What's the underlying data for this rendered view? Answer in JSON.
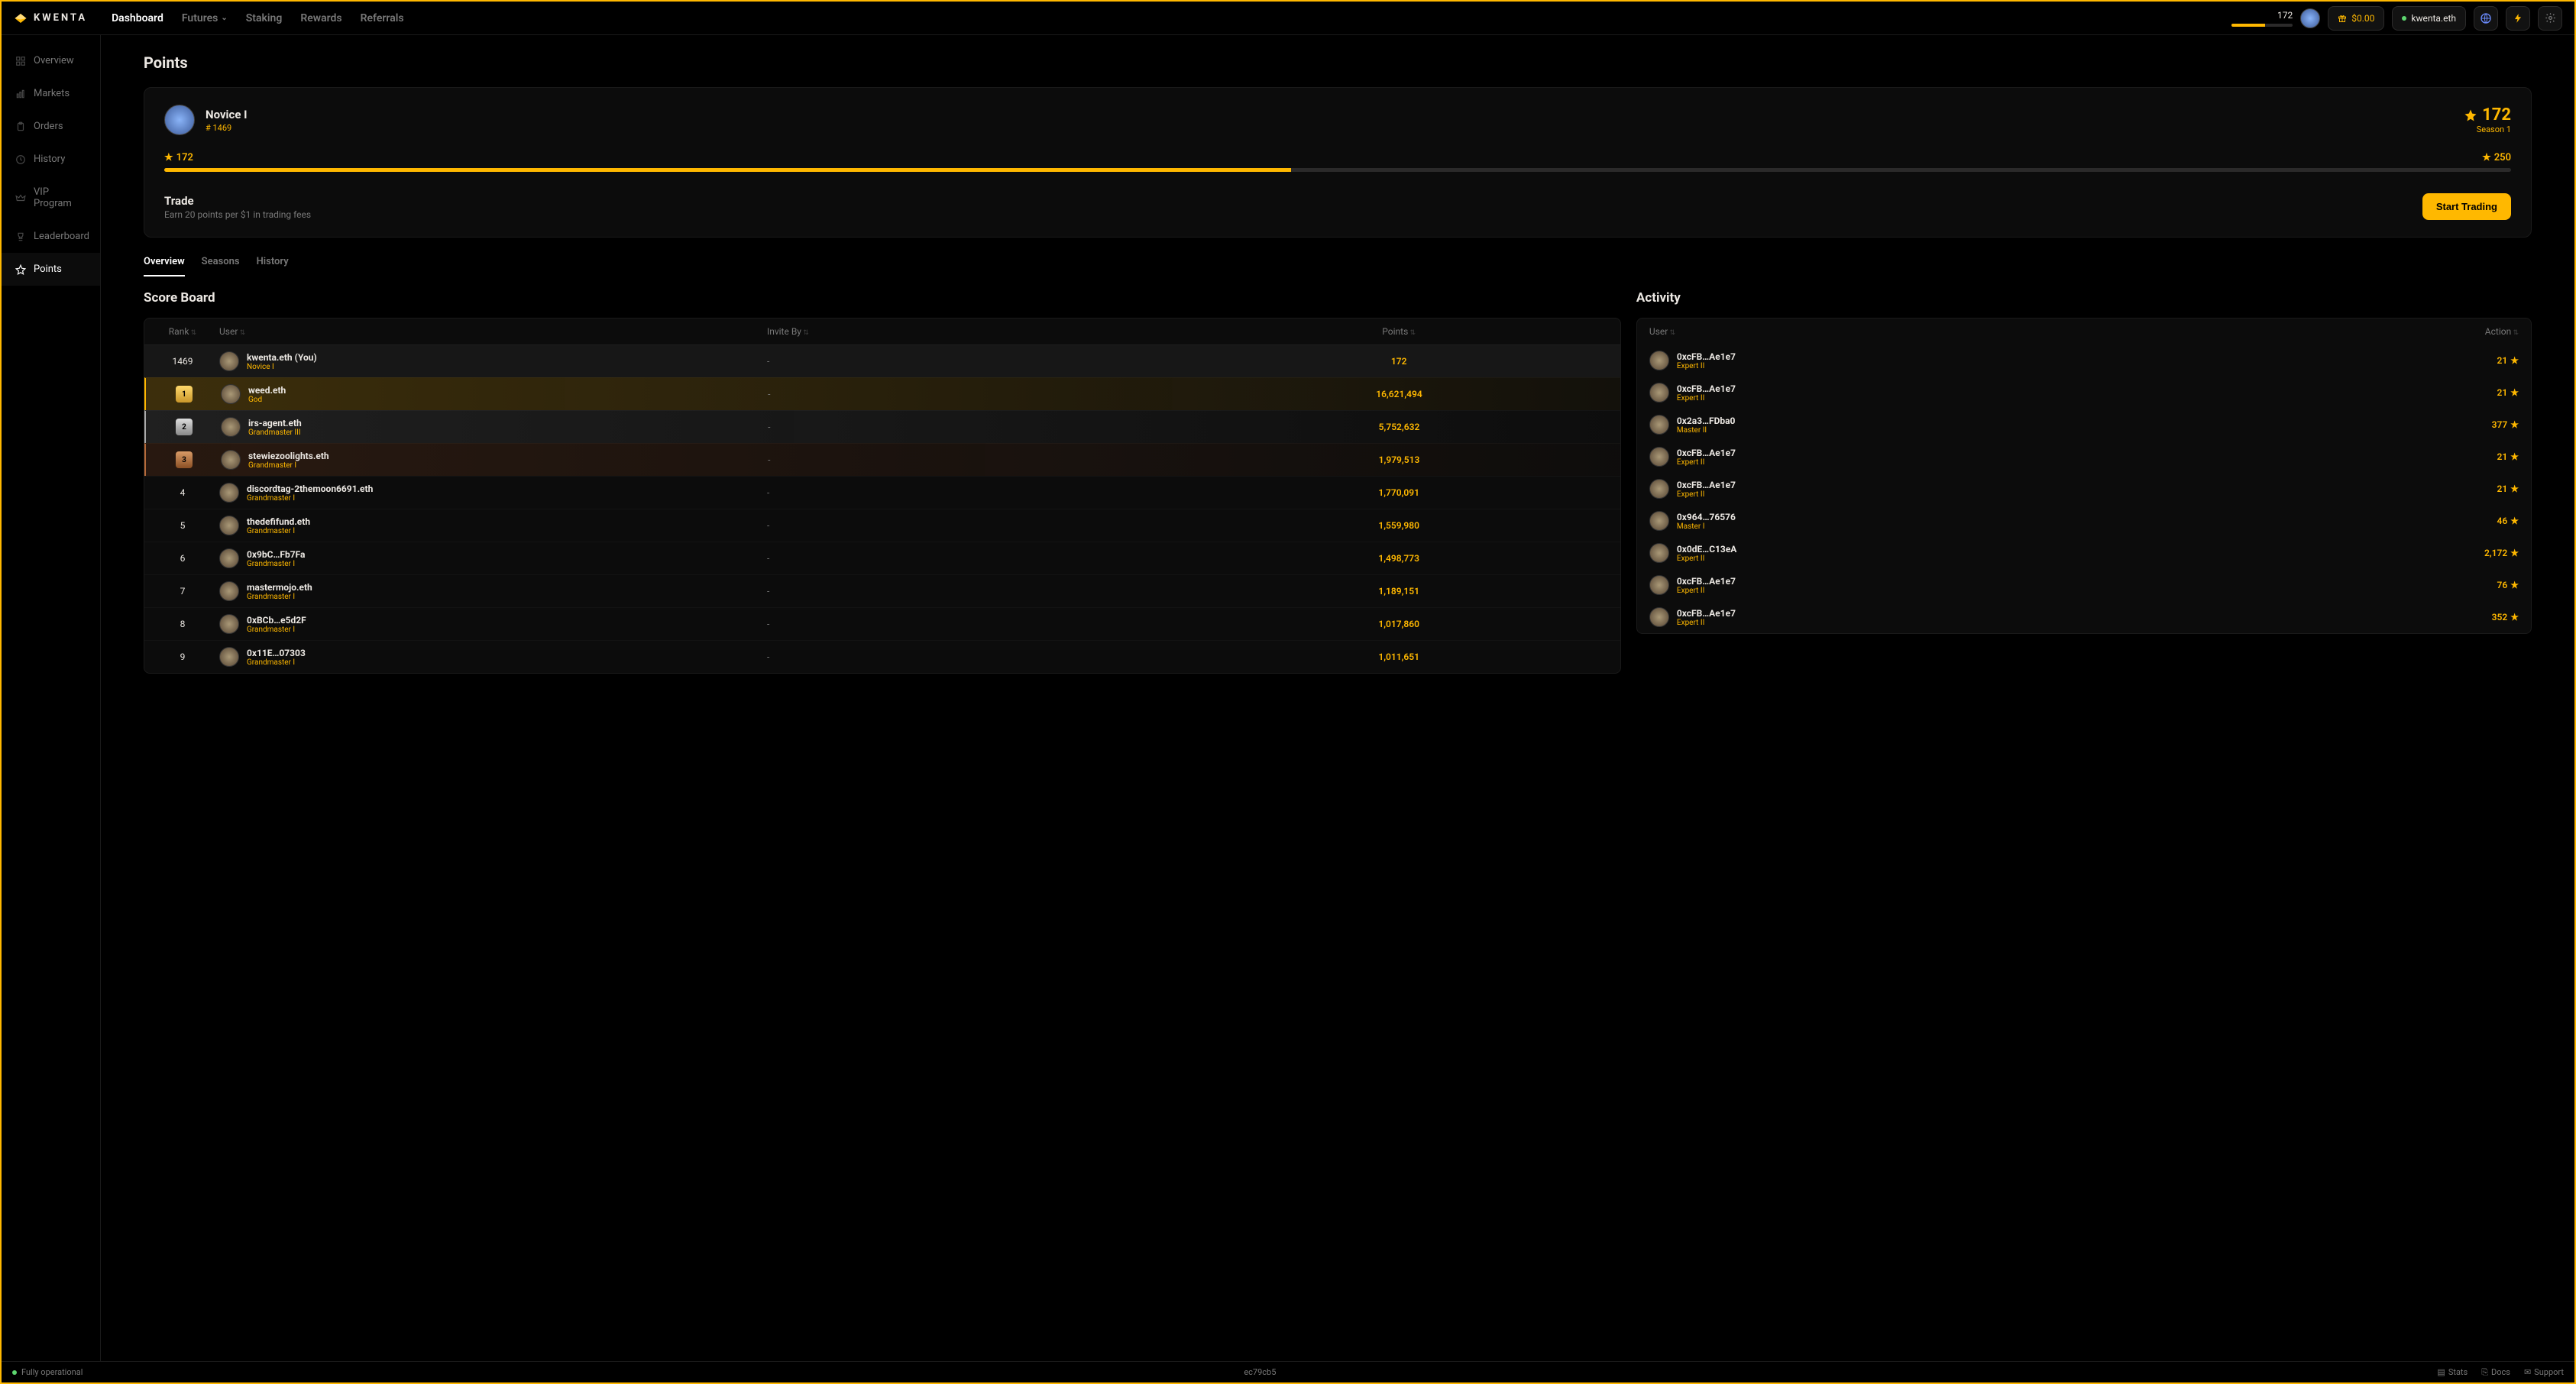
{
  "brand": "KWENTA",
  "nav": {
    "items": [
      "Dashboard",
      "Futures",
      "Staking",
      "Rewards",
      "Referrals"
    ],
    "active": "Dashboard"
  },
  "topbar": {
    "mini_points": "172",
    "mini_progress_pct": 55,
    "balance": "$0.00",
    "wallet": "kwenta.eth"
  },
  "sidebar": {
    "items": [
      {
        "label": "Overview",
        "icon": "grid"
      },
      {
        "label": "Markets",
        "icon": "bars"
      },
      {
        "label": "Orders",
        "icon": "clipboard"
      },
      {
        "label": "History",
        "icon": "history"
      },
      {
        "label": "VIP Program",
        "icon": "crown"
      },
      {
        "label": "Leaderboard",
        "icon": "trophy"
      },
      {
        "label": "Points",
        "icon": "star"
      }
    ],
    "active": "Points"
  },
  "page_title": "Points",
  "hero": {
    "name": "Novice I",
    "rank_label": "# 1469",
    "points": "172",
    "season": "Season 1",
    "left_pts": "172",
    "right_pts": "250",
    "progress_pct": 48,
    "trade_title": "Trade",
    "trade_sub": "Earn 20 points per $1 in trading fees",
    "cta": "Start Trading"
  },
  "tabs": {
    "items": [
      "Overview",
      "Seasons",
      "History"
    ],
    "active": "Overview"
  },
  "scoreboard": {
    "title": "Score Board",
    "headers": {
      "rank": "Rank",
      "user": "User",
      "invite": "Invite By",
      "points": "Points"
    },
    "rows": [
      {
        "rank": "1469",
        "name": "kwenta.eth (You)",
        "tier": "Novice I",
        "invite": "-",
        "points": "172",
        "style": "me"
      },
      {
        "rank": "1",
        "medal": "g",
        "name": "weed.eth",
        "tier": "God",
        "invite": "-",
        "points": "16,621,494",
        "style": "gold"
      },
      {
        "rank": "2",
        "medal": "s",
        "name": "irs-agent.eth",
        "tier": "Grandmaster III",
        "invite": "-",
        "points": "5,752,632",
        "style": "silver"
      },
      {
        "rank": "3",
        "medal": "b",
        "name": "stewiezoolights.eth",
        "tier": "Grandmaster I",
        "invite": "-",
        "points": "1,979,513",
        "style": "bronze"
      },
      {
        "rank": "4",
        "name": "discordtag-2themoon6691.eth",
        "tier": "Grandmaster I",
        "invite": "-",
        "points": "1,770,091"
      },
      {
        "rank": "5",
        "name": "thedefifund.eth",
        "tier": "Grandmaster I",
        "invite": "-",
        "points": "1,559,980"
      },
      {
        "rank": "6",
        "name": "0x9bC…Fb7Fa",
        "tier": "Grandmaster I",
        "invite": "-",
        "points": "1,498,773"
      },
      {
        "rank": "7",
        "name": "mastermojo.eth",
        "tier": "Grandmaster I",
        "invite": "-",
        "points": "1,189,151"
      },
      {
        "rank": "8",
        "name": "0xBCb…e5d2F",
        "tier": "Grandmaster I",
        "invite": "-",
        "points": "1,017,860"
      },
      {
        "rank": "9",
        "name": "0x11E…07303",
        "tier": "Grandmaster I",
        "invite": "-",
        "points": "1,011,651"
      }
    ]
  },
  "activity": {
    "title": "Activity",
    "headers": {
      "user": "User",
      "action": "Action"
    },
    "rows": [
      {
        "name": "0xcFB…Ae1e7",
        "tier": "Expert II",
        "action": "21"
      },
      {
        "name": "0xcFB…Ae1e7",
        "tier": "Expert II",
        "action": "21"
      },
      {
        "name": "0x2a3…FDba0",
        "tier": "Master II",
        "action": "377"
      },
      {
        "name": "0xcFB…Ae1e7",
        "tier": "Expert II",
        "action": "21"
      },
      {
        "name": "0xcFB…Ae1e7",
        "tier": "Expert II",
        "action": "21"
      },
      {
        "name": "0x964…76576",
        "tier": "Master I",
        "action": "46"
      },
      {
        "name": "0x0dE…C13eA",
        "tier": "Expert II",
        "action": "2,172"
      },
      {
        "name": "0xcFB…Ae1e7",
        "tier": "Expert II",
        "action": "76"
      },
      {
        "name": "0xcFB…Ae1e7",
        "tier": "Expert II",
        "action": "352"
      }
    ]
  },
  "footer": {
    "status": "Fully operational",
    "build": "ec79cb5",
    "links": [
      "Stats",
      "Docs",
      "Support"
    ]
  }
}
